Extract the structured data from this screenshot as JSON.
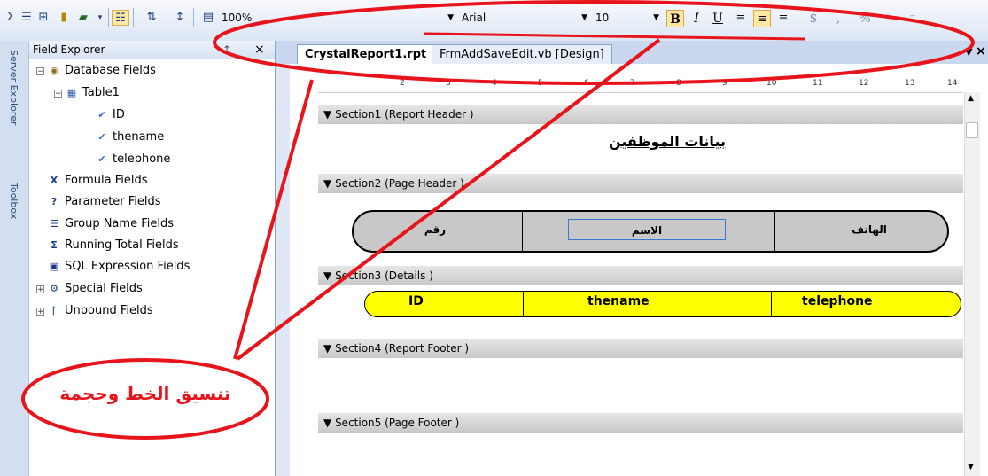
{
  "toolbar": {
    "zoom": "100%",
    "font_name": "Arial",
    "font_size": "10",
    "bold_label": "B",
    "italic_label": "I",
    "underline_label": "U",
    "currency_label": "$",
    "comma_label": ",",
    "percent_label": "%"
  },
  "dock": {
    "server_explorer": "Server Explorer",
    "toolbox": "Toolbox"
  },
  "explorer": {
    "title": "Field Explorer",
    "pin": "↑",
    "close": "×",
    "items": [
      {
        "label": "Database Fields"
      },
      {
        "label": "Table1"
      },
      {
        "label": "ID"
      },
      {
        "label": "thename"
      },
      {
        "label": "telephone"
      },
      {
        "label": "Formula Fields"
      },
      {
        "label": "Parameter Fields"
      },
      {
        "label": "Group Name Fields"
      },
      {
        "label": "Running Total Fields"
      },
      {
        "label": "SQL Expression Fields"
      },
      {
        "label": "Special Fields"
      },
      {
        "label": "Unbound Fields"
      }
    ]
  },
  "tabs": [
    {
      "label": "CrystalReport1.rpt"
    },
    {
      "label": "FrmAddSaveEdit.vb [Design]"
    }
  ],
  "ruler": [
    "2",
    "3",
    "4",
    "5",
    "6",
    "7",
    "8",
    "9",
    "10",
    "11",
    "12",
    "13",
    "14"
  ],
  "sections": [
    {
      "label": "Section1 (Report Header )"
    },
    {
      "label": "Section2 (Page Header )"
    },
    {
      "label": "Section3 (Details )"
    },
    {
      "label": "Section4 (Report Footer )"
    },
    {
      "label": "Section5 (Page Footer )"
    }
  ],
  "report": {
    "title": "بيانات الموظفين",
    "header_fields": [
      "رقم",
      "الاسم",
      "الهاتف"
    ],
    "detail_fields": [
      "ID",
      "thename",
      "telephone"
    ]
  },
  "annotation": {
    "text": "تنسيق الخط وحجمة",
    "color": "#e8141c"
  },
  "colors": {
    "detail_fill": "#ffff00",
    "header_fill": "#c8c8c8",
    "annotation_red": "#e8141c"
  }
}
